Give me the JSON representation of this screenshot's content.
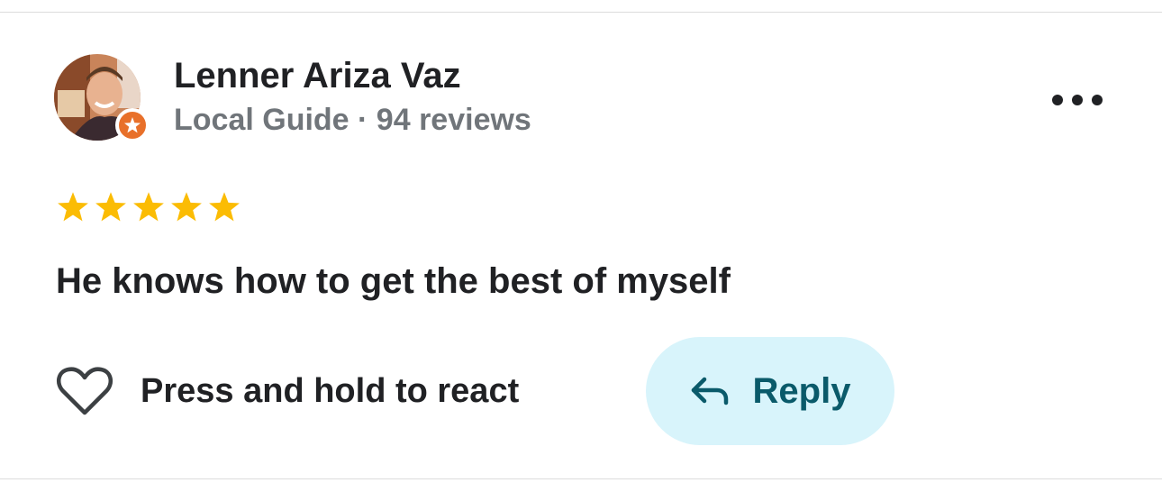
{
  "review": {
    "author": {
      "name": "Lenner Ariza Vaz",
      "subtitle": "Local Guide · 94 reviews",
      "badge_color": "#e8702a"
    },
    "rating": 5,
    "faded_meta": "",
    "text": "He knows how to get the best of myself",
    "actions": {
      "react_label": "Press and hold to react",
      "reply_label": "Reply"
    },
    "icons": [
      "avatar",
      "local-guide-star-icon",
      "more-options-icon",
      "star-icon",
      "heart-icon",
      "reply-arrow-icon"
    ],
    "colors": {
      "star": "#fbbc04",
      "reply_bg": "#d8f4fb",
      "reply_text": "#0a5a6a"
    }
  }
}
